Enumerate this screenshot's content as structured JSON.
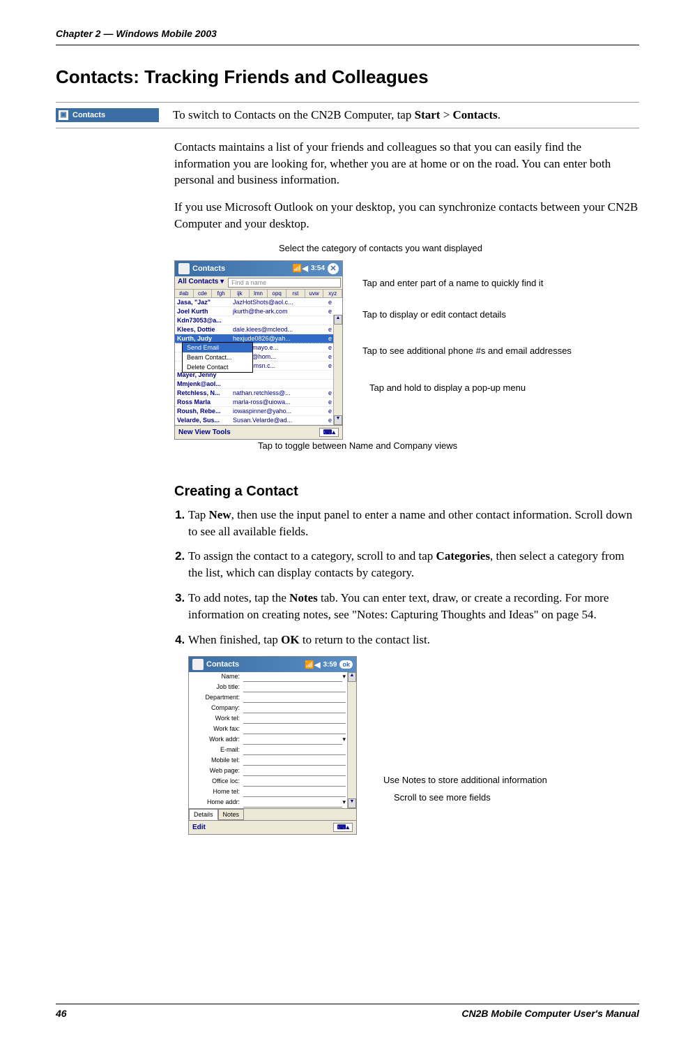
{
  "header": {
    "chapter": "Chapter 2 — Windows Mobile 2003"
  },
  "title": "Contacts: Tracking Friends and Colleagues",
  "intro": {
    "icon_label": "Contacts",
    "switch_text": "To switch to Contacts on the CN2B Computer, tap ",
    "start_word": "Start",
    "sep": " > ",
    "contacts_word": "Contacts",
    "period": "."
  },
  "para1": "Contacts maintains a list of your friends and colleagues so that you can easily find the information you are looking for, whether you are at home or on the road. You can enter both personal and business information.",
  "para2": "If you use Microsoft Outlook on your desktop, you can synchronize contacts between your CN2B Computer and your desktop.",
  "callouts1": {
    "category": "Select the category of contacts you want displayed",
    "findname": "Tap and enter part of a name to quickly find it",
    "details": "Tap to display or edit contact details",
    "additional": "Tap to see additional phone #s and email addresses",
    "popup": "Tap and hold to display a pop-up menu",
    "toggle": "Tap to toggle between Name and Company views"
  },
  "ss1": {
    "title": "Contacts",
    "time": "3:54",
    "close": "✕",
    "category": "All Contacts ▾",
    "findname": "Find a name",
    "alpha": [
      "#ab",
      "cde",
      "fgh",
      "ijk",
      "lmn",
      "opq",
      "rst",
      "uvw",
      "xyz"
    ],
    "rows": [
      {
        "name": "Jasa, \"Jaz\"",
        "email": "JazHotShots@aol.c...",
        "letter": "e"
      },
      {
        "name": "Joel Kurth",
        "email": "jkurth@the-ark.com",
        "letter": "e"
      },
      {
        "name": "Kdn73053@a...",
        "email": "",
        "letter": ""
      },
      {
        "name": "Klees, Dottie",
        "email": "dale.klees@mcleod...",
        "letter": "e"
      }
    ],
    "selected": {
      "name": "Kurth, Judy",
      "email": "hexjude0826@yah...",
      "letter": "e"
    },
    "popup_items": [
      "Send Email",
      "Beam Contact...",
      "Delete Contact"
    ],
    "rows_mid": [
      {
        "email": "linda@mayo.e...",
        "letter": "e"
      },
      {
        "email": "L.Allen@hom...",
        "letter": "e"
      },
      {
        "email": "bert2@msn.c...",
        "letter": "e"
      }
    ],
    "rows2": [
      {
        "name": "Mayer, Jenny",
        "email": "",
        "letter": ""
      },
      {
        "name": "Mmjenk@aol...",
        "email": "",
        "letter": ""
      },
      {
        "name": "Retchless, N...",
        "email": "nathan.retchless@...",
        "letter": "e"
      },
      {
        "name": "Ross Marla",
        "email": "marla-ross@uiowa...",
        "letter": "e"
      },
      {
        "name": "Roush, Rebe...",
        "email": "iowaspinner@yaho...",
        "letter": "e"
      },
      {
        "name": "Velarde, Sus...",
        "email": "Susan.Velarde@ad...",
        "letter": "e"
      }
    ],
    "menu": "New  View  Tools"
  },
  "creating_title": "Creating a Contact",
  "steps": {
    "s1a": "Tap ",
    "s1_new": "New",
    "s1b": ", then use the input panel to enter a name and other contact information. Scroll down to see all available fields.",
    "s2a": "To assign the contact to a category, scroll to and tap ",
    "s2_cat": "Categories",
    "s2b": ", then select a category from the list, which can display contacts by category.",
    "s3a": "To add notes, tap the ",
    "s3_notes": "Notes",
    "s3b": " tab. You can enter text, draw, or create a recording. For more information on creating notes, see \"Notes: Capturing Thoughts and Ideas\" on page 54.",
    "s4a": "When finished, tap ",
    "s4_ok": "OK",
    "s4b": " to return to the contact list."
  },
  "ss2": {
    "title": "Contacts",
    "time": "3:59",
    "ok": "ok",
    "labels": [
      "Name:",
      "Job title:",
      "Department:",
      "Company:",
      "Work tel:",
      "Work fax:",
      "Work addr:",
      "E-mail:",
      "Mobile tel:",
      "Web page:",
      "Office loc:",
      "Home tel:",
      "Home addr:"
    ],
    "tabs": [
      "Details",
      "Notes"
    ],
    "edit": "Edit"
  },
  "callouts2": {
    "notes": "Use Notes to store additional information",
    "scroll": "Scroll to see more fields"
  },
  "footer": {
    "page": "46",
    "manual": "CN2B Mobile Computer User's Manual"
  }
}
